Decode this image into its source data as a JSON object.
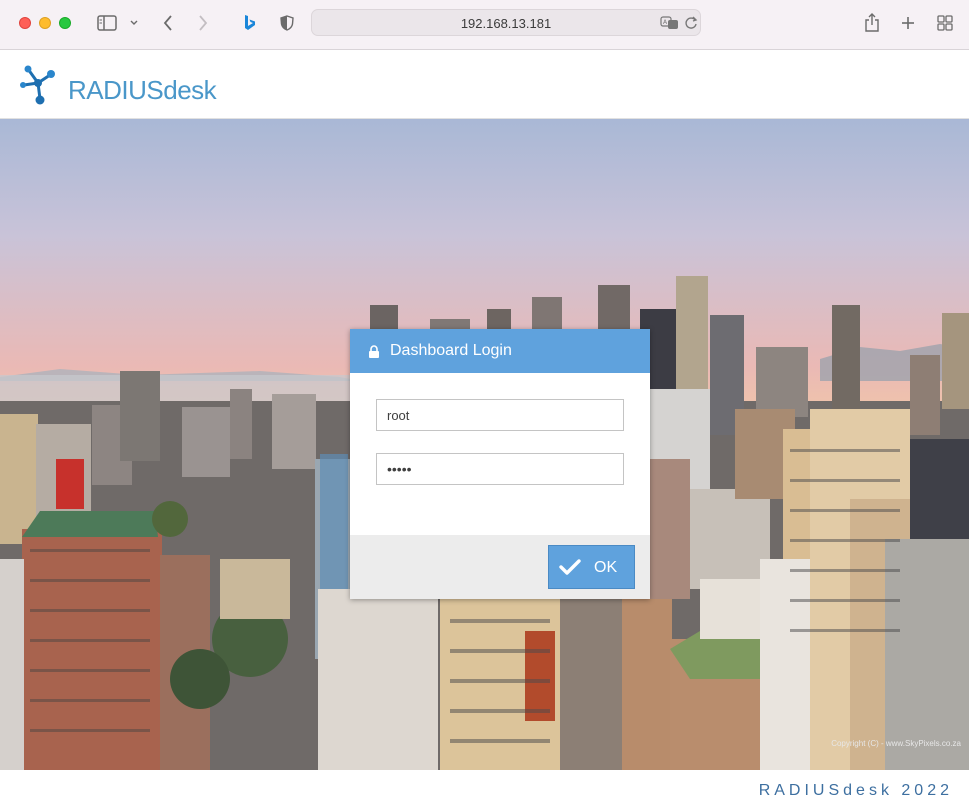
{
  "browser": {
    "url": "192.168.13.181"
  },
  "app": {
    "brand": "RADIUSdesk"
  },
  "login": {
    "title": "Dashboard Login",
    "username": "root",
    "password_mask": "•••••",
    "ok_label": "OK"
  },
  "background": {
    "credit": "Copyright (C) - www.SkyPixels.co.za"
  },
  "footer": {
    "text": "RADIUSdesk 2022"
  },
  "colors": {
    "accent": "#5fa2dd",
    "brand": "#4a97c9",
    "footer_text": "#3d6fa0"
  }
}
